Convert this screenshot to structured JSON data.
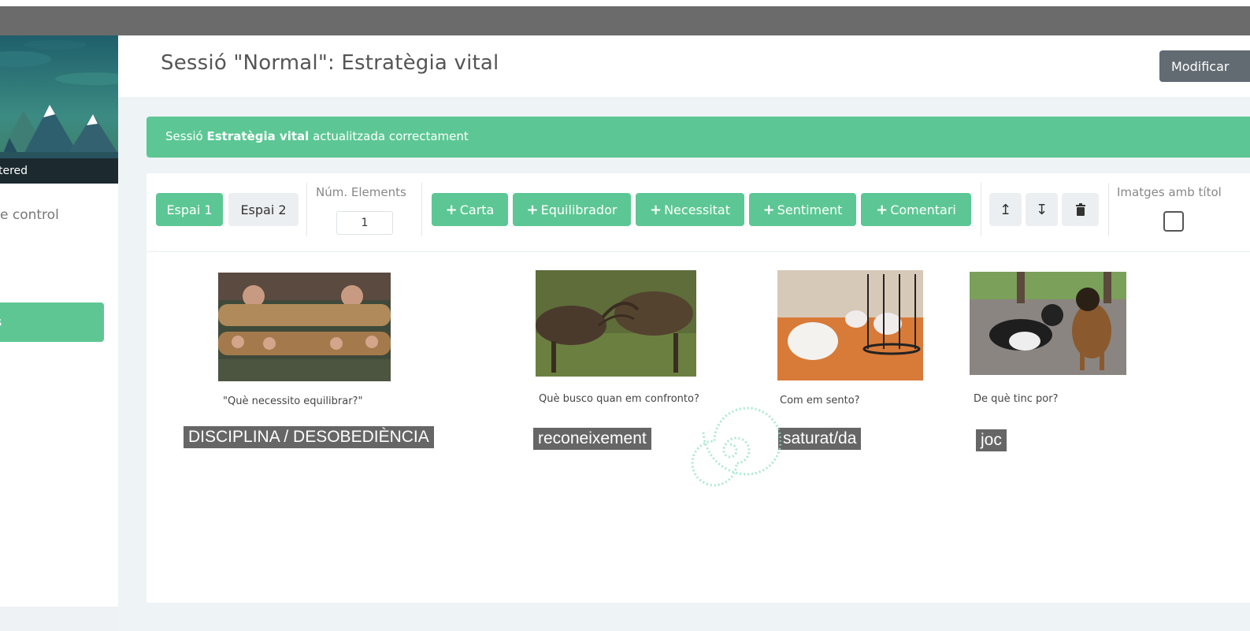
{
  "header": {
    "title": "Sessió \"Normal\": Estratègia vital",
    "modify_label": "Modificar"
  },
  "sidebar": {
    "banner_label": "tered",
    "link_label": "e control"
  },
  "alert": {
    "prefix": "Sessió ",
    "bold": "Estratègia vital",
    "suffix": " actualitzada correctament"
  },
  "toolbar": {
    "space1": "Espai 1",
    "space2": "Espai 2",
    "num_elements_label": "Núm. Elements",
    "num_elements_value": "1",
    "buttons": [
      "Carta",
      "Equilibrador",
      "Necessitat",
      "Sentiment",
      "Comentari"
    ],
    "images_with_title_label": "Imatges amb títol"
  },
  "cards": [
    {
      "question": "\"Què necessito equilibrar?\"",
      "tag": "DISCIPLINA / DESOBEDIÈNCIA"
    },
    {
      "question": "Què busco quan em confronto?",
      "tag": "reconeixement"
    },
    {
      "question": "Com em sento?",
      "tag": "saturat/da"
    },
    {
      "question": "De què tinc por?",
      "tag": "joc"
    }
  ]
}
